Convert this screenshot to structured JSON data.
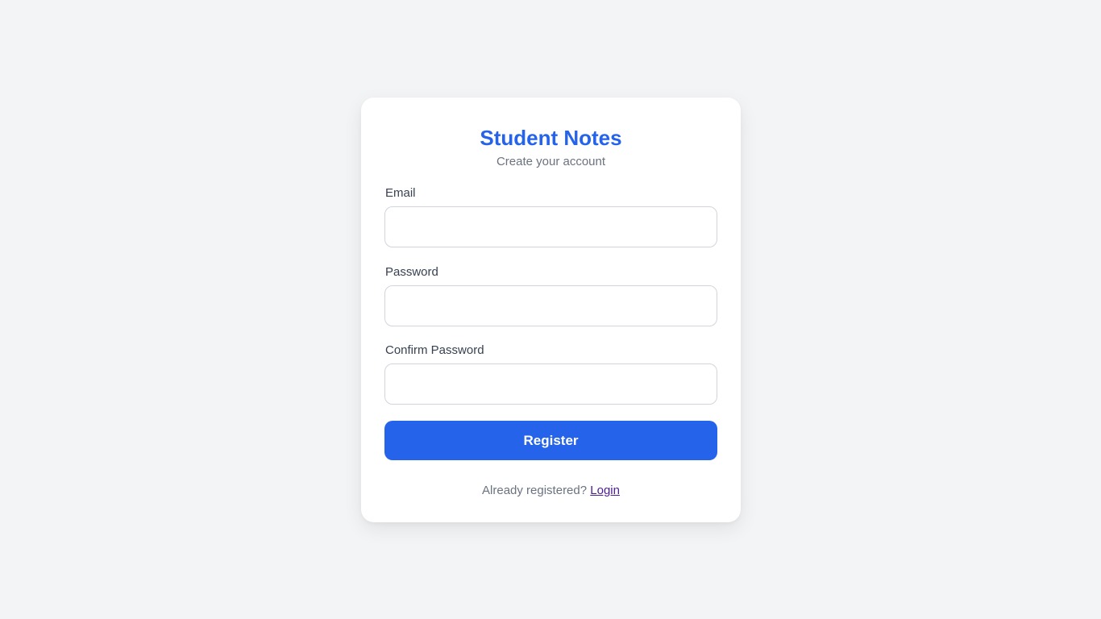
{
  "card": {
    "title": "Student Notes",
    "subtitle": "Create your account"
  },
  "form": {
    "email": {
      "label": "Email",
      "value": "",
      "placeholder": ""
    },
    "password": {
      "label": "Password",
      "value": "",
      "placeholder": ""
    },
    "confirm_password": {
      "label": "Confirm Password",
      "value": "",
      "placeholder": ""
    },
    "register_label": "Register"
  },
  "footer": {
    "prompt": "Already registered?",
    "login_label": "Login"
  },
  "colors": {
    "accent": "#2563eb",
    "background": "#f3f4f6",
    "link_visited": "#4c1d95"
  }
}
